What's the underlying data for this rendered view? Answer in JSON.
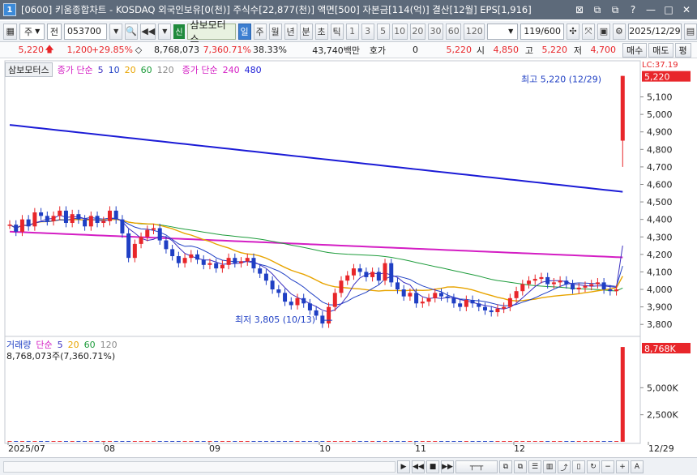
{
  "window": {
    "badge": "1",
    "title": "[0600] 키움종합차트 - KOSDAQ 외국인보유[0(천)] 주식수[22,877(천)] 액면[500] 자본금[114(억)] 결산[12월] EPS[1,916]",
    "controls": [
      "⊠",
      "⧉",
      "⧉",
      "?",
      "—",
      "□",
      "✕"
    ]
  },
  "toolbar": {
    "market": "주",
    "prev": "전",
    "code": "053700",
    "flag": "신",
    "stock_name": "삼보모터스",
    "periods": [
      "일",
      "주",
      "월",
      "년",
      "분",
      "초",
      "틱"
    ],
    "active_period": "일",
    "intervals": [
      "1",
      "3",
      "5",
      "10",
      "20",
      "30",
      "60",
      "120"
    ],
    "count": "119/600",
    "date": "2025/12/29"
  },
  "quote": {
    "price": "5,220",
    "change": "1,200",
    "change_pct": "+29.85%",
    "volume": "8,768,073",
    "volume_pct": "7,360.71%",
    "turnover": "38.33%",
    "amount": "43,740백만",
    "hoga_label": "호가",
    "hoga_value": "0",
    "hoga_price": "5,220",
    "open_label": "시",
    "open": "4,850",
    "high_label": "고",
    "high": "5,220",
    "low_label": "저",
    "low": "4,700",
    "buy": "매수",
    "sell": "매도",
    "flat": "평"
  },
  "price_panel": {
    "stock_tag": "삼보모터스",
    "legend1_label": "종가 단순",
    "legend1_periods": [
      "5",
      "10",
      "20",
      "60",
      "120"
    ],
    "legend2_label": "종가 단순",
    "legend2_periods": [
      "240",
      "480"
    ],
    "high_note": "최고 5,220 (12/29)",
    "low_note": "최저 3,805 (10/13)",
    "lc_label": "LC:37.19",
    "current_tag": "5,220",
    "current_pct": "29.85%",
    "y_ticks": [
      "5,100",
      "5,000",
      "4,900",
      "4,800",
      "4,700",
      "4,600",
      "4,500",
      "4,400",
      "4,300",
      "4,200",
      "4,100",
      "4,000",
      "3,900",
      "3,800"
    ]
  },
  "volume_panel": {
    "label": "거래량",
    "legend_label": "단순",
    "periods": [
      "5",
      "20",
      "60",
      "120"
    ],
    "value_text": "8,768,073주(7,360.71%)",
    "current_tag": "8,768K",
    "current_pct": "7360.71%",
    "y_ticks": [
      "5,000K",
      "2,500K"
    ]
  },
  "x_axis": [
    "2025/07",
    "08",
    "09",
    "10",
    "11",
    "12",
    "12/29"
  ],
  "colors": {
    "up": "#e8262a",
    "down": "#1f3fc4",
    "ma5": "#3b2fc0",
    "ma10": "#1f3fc4",
    "ma20": "#e8a400",
    "ma60": "#1c9b3a",
    "ma120": "#8a8a8a",
    "ma240": "#d41ec4",
    "ma480": "#1b1bd6"
  },
  "chart_data": {
    "type": "candlestick",
    "last_candle": {
      "date": "12/29",
      "open": 4850,
      "high": 5220,
      "low": 4700,
      "close": 5220,
      "volume": 8768073
    },
    "extremes": {
      "high": {
        "value": 5220,
        "date": "12/29"
      },
      "low": {
        "value": 3805,
        "date": "10/13"
      }
    },
    "ylim": [
      3750,
      5260
    ],
    "closes": [
      4370,
      4330,
      4400,
      4360,
      4440,
      4420,
      4390,
      4420,
      4450,
      4380,
      4430,
      4400,
      4360,
      4420,
      4380,
      4390,
      4450,
      4400,
      4320,
      4180,
      4260,
      4300,
      4340,
      4350,
      4280,
      4230,
      4190,
      4150,
      4180,
      4200,
      4170,
      4140,
      4150,
      4120,
      4140,
      4180,
      4150,
      4160,
      4180,
      4120,
      4090,
      4050,
      4000,
      3980,
      3930,
      3910,
      3950,
      3920,
      3880,
      3850,
      3805,
      3900,
      3980,
      4050,
      4080,
      4120,
      4100,
      4070,
      4100,
      4050,
      4150,
      4040,
      4000,
      3960,
      3980,
      3920,
      3930,
      3950,
      3980,
      3960,
      3950,
      3920,
      3900,
      3940,
      3920,
      3900,
      3880,
      3870,
      3890,
      3900,
      3950,
      3990,
      4030,
      4050,
      4060,
      4070,
      4030,
      4040,
      4050,
      4030,
      4000,
      4010,
      4020,
      4030,
      4040,
      4000,
      3990,
      4000,
      5220
    ],
    "volume_last": 8768073
  }
}
